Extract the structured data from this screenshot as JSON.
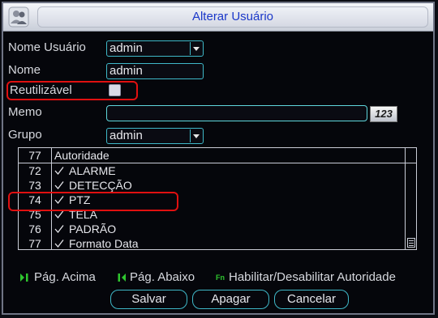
{
  "dialog": {
    "title": "Alterar Usuário",
    "title_icon": "users-icon"
  },
  "form": {
    "username_label": "Nome Usuário",
    "username_value": "admin",
    "name_label": "Nome",
    "name_value": "admin",
    "reusable_label": "Reutilizável",
    "reusable_checked": false,
    "memo_label": "Memo",
    "memo_value": "",
    "keypad_label": "123",
    "group_label": "Grupo",
    "group_value": "admin"
  },
  "authority_table": {
    "header_num": "77",
    "header_label": "Autoridade",
    "rows": [
      {
        "num": "72",
        "label": "ALARME",
        "checked": true
      },
      {
        "num": "73",
        "label": "DETECÇÃO",
        "checked": true
      },
      {
        "num": "74",
        "label": "PTZ",
        "checked": true
      },
      {
        "num": "75",
        "label": "TELA",
        "checked": true
      },
      {
        "num": "76",
        "label": "PADRÃO",
        "checked": true
      },
      {
        "num": "77",
        "label": "Formato Data",
        "checked": true
      }
    ]
  },
  "hints": {
    "page_up": "Pág. Acima",
    "page_down": "Pág. Abaixo",
    "fn_badge": "Fn",
    "toggle_authority": "Habilitar/Desabilitar Autoridade"
  },
  "buttons": {
    "save": "Salvar",
    "delete": "Apagar",
    "cancel": "Cancelar"
  },
  "colors": {
    "accent_border": "#3fb8c8",
    "title_text": "#1a37c9",
    "highlight": "#e01010",
    "hint_icon": "#2ec52e"
  }
}
